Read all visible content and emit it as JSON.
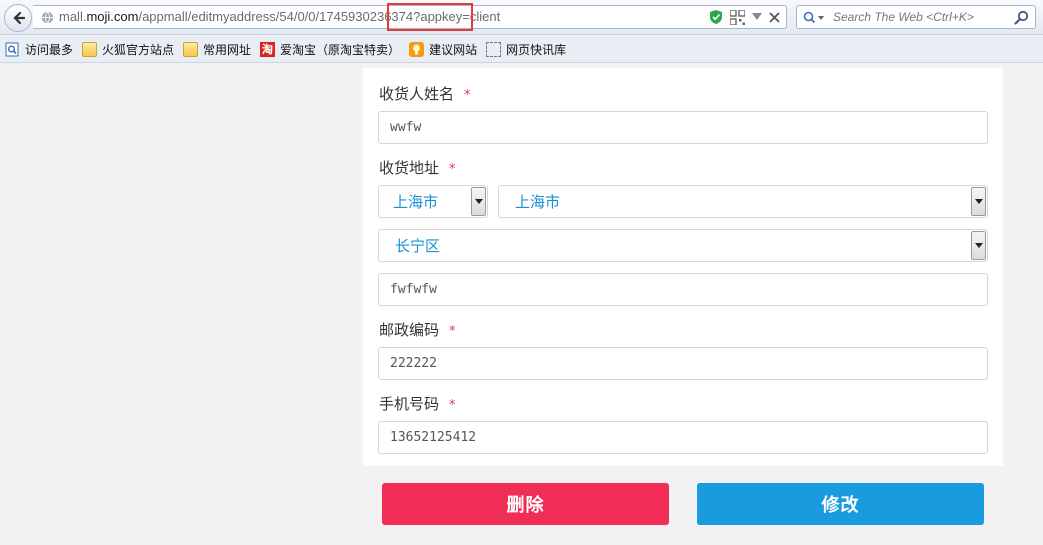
{
  "browser": {
    "url": {
      "host_prefix": "mall.",
      "host_domain": "moji.com",
      "path_before": "/appmall/editmyaddress/54/0/0/17459302",
      "path_highlight": "36374?appkey",
      "path_after": "=client"
    },
    "search_placeholder": "Search The Web <Ctrl+K>",
    "bookmarks": [
      {
        "label": "访问最多",
        "icon": "search-page-icon"
      },
      {
        "label": "火狐官方站点",
        "icon": "folder-icon"
      },
      {
        "label": "常用网址",
        "icon": "folder-icon"
      },
      {
        "label": "爱淘宝（原淘宝特卖）",
        "icon": "taobao-icon",
        "icon_text": "淘"
      },
      {
        "label": "建议网站",
        "icon": "bulb-icon"
      },
      {
        "label": "网页快讯库",
        "icon": "web-slice-icon"
      }
    ],
    "highlight_color": "#e03a3a"
  },
  "form": {
    "name_label": "收货人姓名",
    "name_value": "wwfw",
    "address_label": "收货地址",
    "province": "上海市",
    "city": "上海市",
    "district": "长宁区",
    "street_value": "fwfwfw",
    "postcode_label": "邮政编码",
    "postcode_value": "222222",
    "phone_label": "手机号码",
    "phone_value": "13652125412",
    "required_mark": "*",
    "accent_color": "#1a8fd4",
    "required_color": "#e8345a"
  },
  "actions": {
    "delete_label": "删除",
    "edit_label": "修改",
    "delete_color": "#ef2d56",
    "edit_color": "#1a9be0"
  }
}
